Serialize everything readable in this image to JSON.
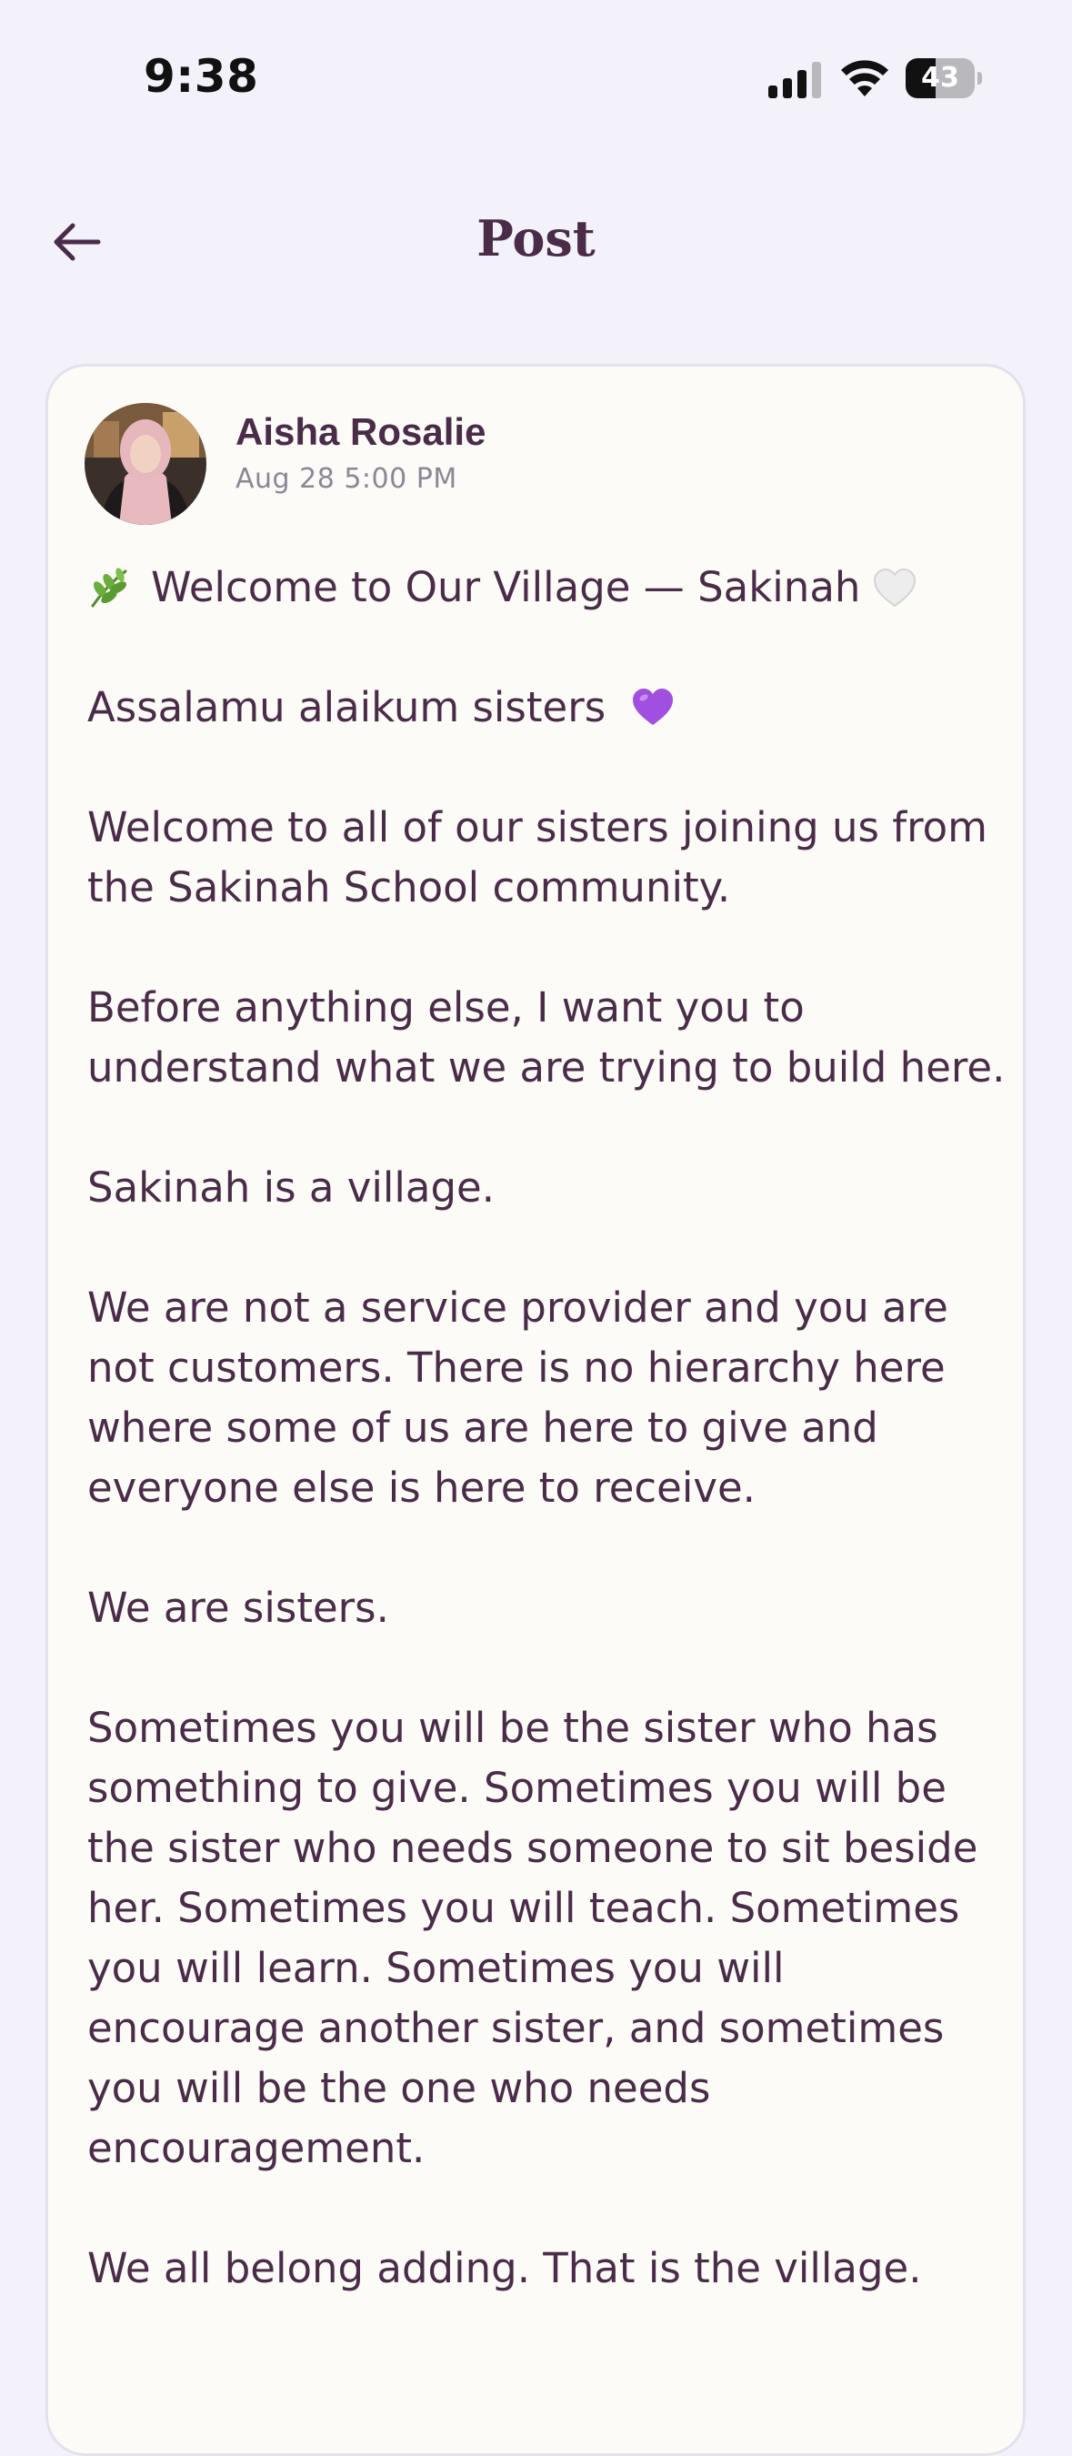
{
  "status_bar": {
    "time": "9:38",
    "battery_level": "43",
    "battery_percent": 43
  },
  "header": {
    "title": "Post",
    "back_icon": "arrow-left-icon"
  },
  "post": {
    "author_name": "Aisha Rosalie",
    "date": "Aug 28 5:00 PM",
    "avatar": "author-avatar-photo",
    "title_line": "Welcome to Our Village — Sakinah",
    "title_icon": "herb-leaf-icon",
    "title_trailing_icon": "white-heart-icon",
    "greeting": "Assalamu alaikum sisters",
    "greeting_icon": "purple-heart-icon",
    "paragraphs": [
      "Welcome to all of our sisters joining us from the Sakinah School community.",
      "Before anything else, I want you to understand what we are trying to build here.",
      "Sakinah is a village.",
      "We are not a service provider and you are not customers. There is no hierarchy here where some of us are here to give and everyone else is here to receive.",
      "We are sisters.",
      "Sometimes you will be the sister who has something to give. Sometimes you will be the sister who needs someone to sit beside her. Sometimes you will teach. Sometimes you will learn. Sometimes you will encourage another sister, and sometimes you will be the one who needs encouragement.",
      "We all belong adding. That is the village."
    ]
  },
  "colors": {
    "background": "#f3f2fa",
    "card": "#fcfbf7",
    "text_primary": "#4a2c48",
    "text_muted": "#8c8796",
    "accent_heart": "#a14fe0"
  }
}
